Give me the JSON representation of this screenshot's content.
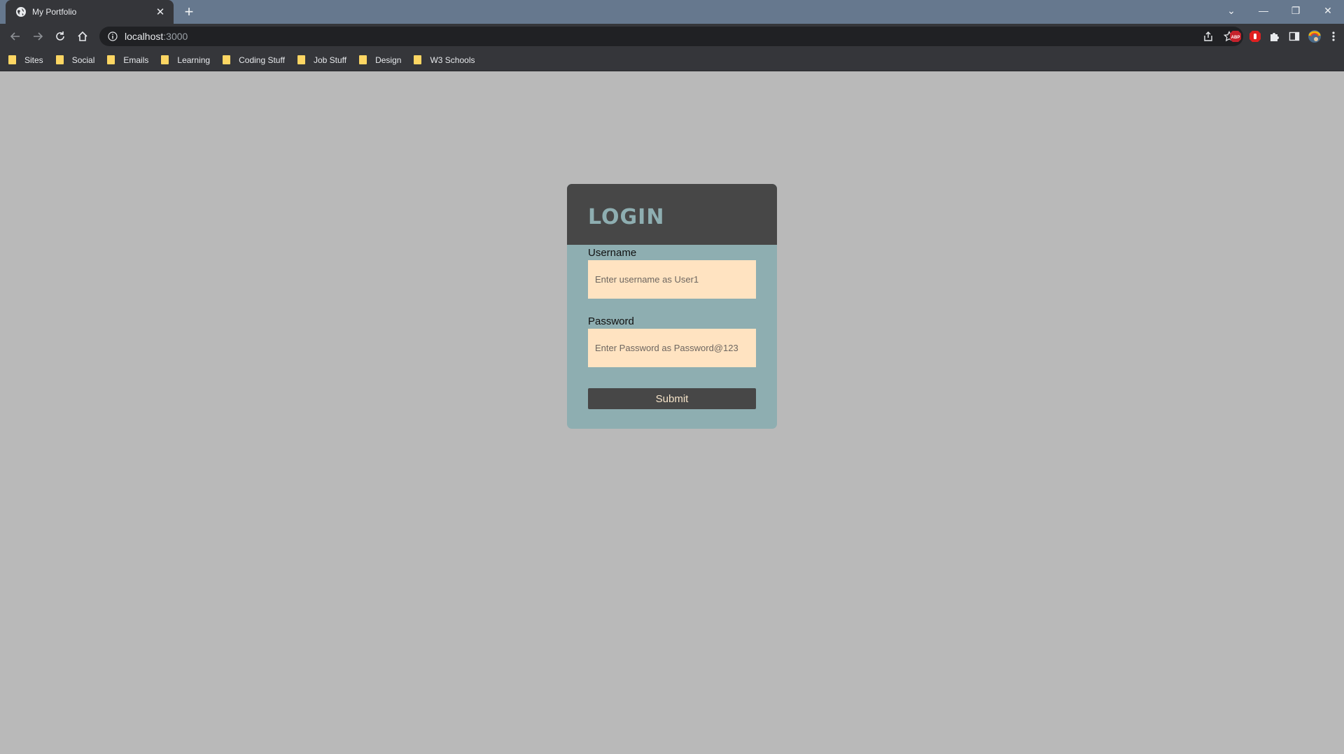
{
  "browser": {
    "tab_title": "My Portfolio",
    "tab_close": "✕",
    "new_tab": "+",
    "url_host": "localhost",
    "url_port": ":3000",
    "window_controls": [
      "⌄",
      "—",
      "❐",
      "✕"
    ],
    "bookmarks": [
      "Sites",
      "Social",
      "Emails",
      "Learning",
      "Coding Stuff",
      "Job Stuff",
      "Design",
      "W3 Schools"
    ],
    "ext_abp_label": "ABP"
  },
  "login": {
    "title": "LOGIN",
    "username_label": "Username",
    "username_placeholder": "Enter username as User1",
    "password_label": "Password",
    "password_placeholder": "Enter Password as Password@123",
    "submit_label": "Submit"
  },
  "colors": {
    "page_bg": "#b9b9b9",
    "card_bg": "#8eaeb1",
    "card_header_bg": "#474747",
    "input_bg": "#ffe3c1",
    "button_bg": "#474747"
  }
}
